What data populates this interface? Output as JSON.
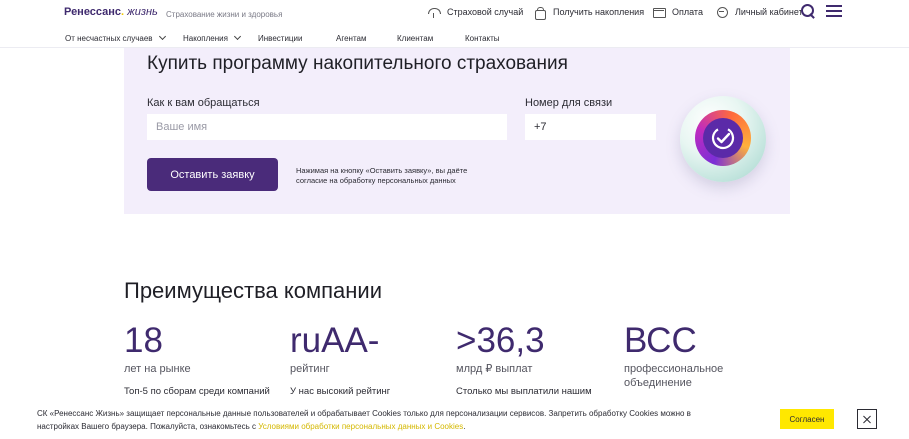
{
  "header": {
    "logo_main": "Ренессанс",
    "logo_dot": ".",
    "logo_sub": "жизнь",
    "tagline": "Страхование жизни и здоровья",
    "top_links": [
      {
        "label": "Страховой случай",
        "icon": "umbrella-icon"
      },
      {
        "label": "Получить накопления",
        "icon": "bag-icon"
      },
      {
        "label": "Оплата",
        "icon": "card-icon"
      },
      {
        "label": "Личный кабинет",
        "icon": "login-icon"
      }
    ],
    "sub_nav": [
      {
        "label": "От несчастных случаев",
        "has_dropdown": true
      },
      {
        "label": "Накопления",
        "has_dropdown": true
      },
      {
        "label": "Инвестиции",
        "has_dropdown": false
      },
      {
        "label": "Агентам",
        "has_dropdown": false
      },
      {
        "label": "Клиентам",
        "has_dropdown": false
      },
      {
        "label": "Контакты",
        "has_dropdown": false
      }
    ]
  },
  "form": {
    "title": "Купить программу накопительного страхования",
    "name_label": "Как к вам обращаться",
    "name_placeholder": "Ваше имя",
    "phone_label": "Номер для связи",
    "phone_value": "+7",
    "submit_label": "Оставить заявку",
    "consent_line1": "Нажимая на кнопку «Оставить заявку», вы даёте",
    "consent_line2": "согласие на обработку персональных данных"
  },
  "advantages": {
    "title": "Преимущества компании",
    "items": [
      {
        "value": "18",
        "label": "лет на рынке",
        "desc": "Топ-5 по сборам среди компаний"
      },
      {
        "value": "ruAA-",
        "label": "рейтинг",
        "desc": "У нас высокий рейтинг"
      },
      {
        "value": ">36,3",
        "label": "млрд ₽ выплат",
        "desc": "Столько мы выплатили нашим"
      },
      {
        "value": "ВСС",
        "label": "профессиональное объединение",
        "desc": ""
      }
    ]
  },
  "cookie": {
    "line1": "СК «Ренессанс Жизнь» защищает персональные данные пользователей и обрабатывает Cookies только для персонализации сервисов. Запретить обработку Cookies можно в",
    "line2_prefix": "настройках Вашего браузера. Пожалуйста, ознакомьтесь с ",
    "line2_link": "Условиями обработки персональных данных и Cookies",
    "line2_suffix": ".",
    "agree_label": "Согласен"
  },
  "colors": {
    "brand_purple": "#3f2a6e",
    "button_purple": "#4a2b7a",
    "card_bg": "#f3eefb",
    "accent_yellow": "#ffe800"
  }
}
